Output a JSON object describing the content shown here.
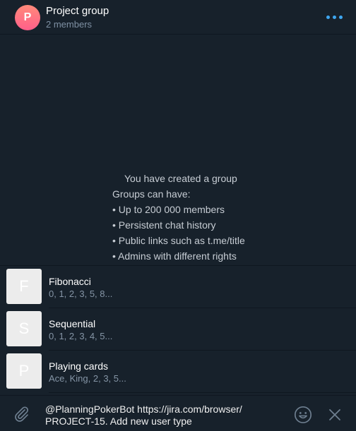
{
  "header": {
    "avatar_letter": "P",
    "title": "Project group",
    "subtitle": "2 members"
  },
  "service_message": {
    "heading": "You have created a group",
    "intro": "Groups can have:",
    "items": [
      "• Up to 200 000 members",
      "• Persistent chat history",
      "• Public links such as t.me/title",
      "• Admins with different rights"
    ]
  },
  "inline_results": [
    {
      "letter": "F",
      "title": "Fibonacci",
      "description": "0, 1, 2, 3, 5, 8..."
    },
    {
      "letter": "S",
      "title": "Sequential",
      "description": "0, 1, 2, 3, 4, 5..."
    },
    {
      "letter": "P",
      "title": "Playing cards",
      "description": "Ace, King, 2, 3, 5..."
    }
  ],
  "composer": {
    "line1": "@PlanningPokerBot https://jira.com/browser/",
    "line2": "PROJECT-15. Add new user type"
  },
  "icons": {
    "menu": "more-dots-icon",
    "attach": "paperclip-icon",
    "emoji": "smiley-icon",
    "close": "close-icon"
  },
  "colors": {
    "background": "#17212b",
    "accent": "#3ea6f0",
    "secondary_text": "#7f91a4"
  }
}
